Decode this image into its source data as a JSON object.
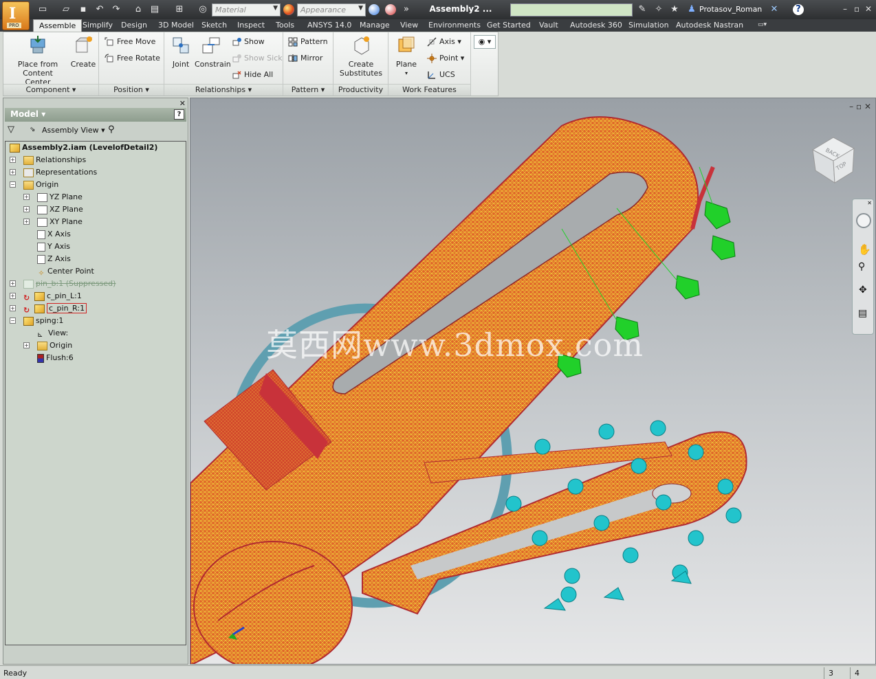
{
  "app": {
    "title": "Assembly2 ...",
    "badge": "PRO",
    "user": "Protasov_Roman",
    "material_placeholder": "Material",
    "appearance_placeholder": "Appearance"
  },
  "tabs": [
    "Assemble",
    "Simplify",
    "Design",
    "3D Model",
    "Sketch",
    "Inspect",
    "Tools",
    "ANSYS 14.0",
    "Manage",
    "View",
    "Environments",
    "Get Started",
    "Vault",
    "Autodesk 360",
    "Simulation",
    "Autodesk Nastran"
  ],
  "ribbon": {
    "component": {
      "title": "Component",
      "place": "Place from\nContent Center",
      "create": "Create"
    },
    "position": {
      "title": "Position",
      "free_move": "Free Move",
      "free_rotate": "Free Rotate"
    },
    "relationships": {
      "title": "Relationships",
      "joint": "Joint",
      "constrain": "Constrain",
      "show": "Show",
      "show_sick": "Show Sick",
      "hide_all": "Hide All"
    },
    "pattern": {
      "title": "Pattern",
      "pattern": "Pattern",
      "mirror": "Mirror"
    },
    "productivity": {
      "title": "Productivity",
      "create_substitutes": "Create\nSubstitutes"
    },
    "work_features": {
      "title": "Work Features",
      "plane": "Plane",
      "axis": "Axis",
      "point": "Point",
      "ucs": "UCS"
    }
  },
  "browser": {
    "header": "Model",
    "view": "Assembly View",
    "tree": [
      {
        "label": "Assembly2.iam (LevelofDetail2)"
      },
      {
        "label": "Relationships"
      },
      {
        "label": "Representations"
      },
      {
        "label": "Origin"
      },
      {
        "label": "YZ Plane"
      },
      {
        "label": "XZ Plane"
      },
      {
        "label": "XY Plane"
      },
      {
        "label": "X Axis"
      },
      {
        "label": "Y Axis"
      },
      {
        "label": "Z Axis"
      },
      {
        "label": "Center Point"
      },
      {
        "label": "pin_b:1 (Suppressed)"
      },
      {
        "label": "c_pin_L:1"
      },
      {
        "label": "c_pin_R:1"
      },
      {
        "label": "sping:1"
      },
      {
        "label": "View:"
      },
      {
        "label": "Origin"
      },
      {
        "label": "Flush:6"
      }
    ]
  },
  "viewport": {
    "watermark": "莫西网www.3dmox.com",
    "viewcube_back": "BACK",
    "viewcube_top": "TOP"
  },
  "status": {
    "text": "Ready",
    "count1": "3",
    "count2": "4"
  },
  "colors": {
    "mesh_orange": "#e0662a",
    "mesh_red": "#c8323a",
    "constraint_green": "#21d02a",
    "load_cyan": "#22c4cc",
    "spring_blue": "#5f9fb0"
  }
}
